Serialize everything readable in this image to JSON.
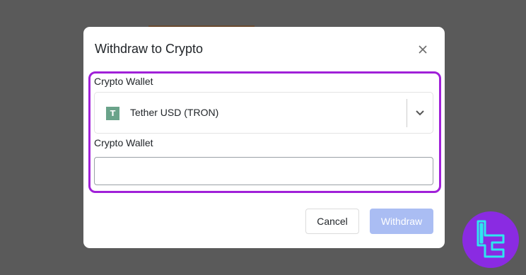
{
  "modal": {
    "title": "Withdraw to Crypto",
    "close_icon": "close-icon"
  },
  "wallet_select": {
    "label": "Crypto Wallet",
    "selected_value": "Tether USD (TRON)",
    "coin_icon_glyph": "T",
    "coin_icon_color": "#6aa38a",
    "dropdown_icon": "chevron-down-icon"
  },
  "address_field": {
    "label": "Crypto Wallet",
    "value": "",
    "placeholder": ""
  },
  "footer": {
    "cancel_label": "Cancel",
    "withdraw_label": "Withdraw"
  },
  "colors": {
    "highlight": "#a020d8",
    "withdraw_disabled": "#aabdf3",
    "brand_logo_bg": "#8a2be2",
    "brand_logo_fg": "#2ee6f0"
  }
}
